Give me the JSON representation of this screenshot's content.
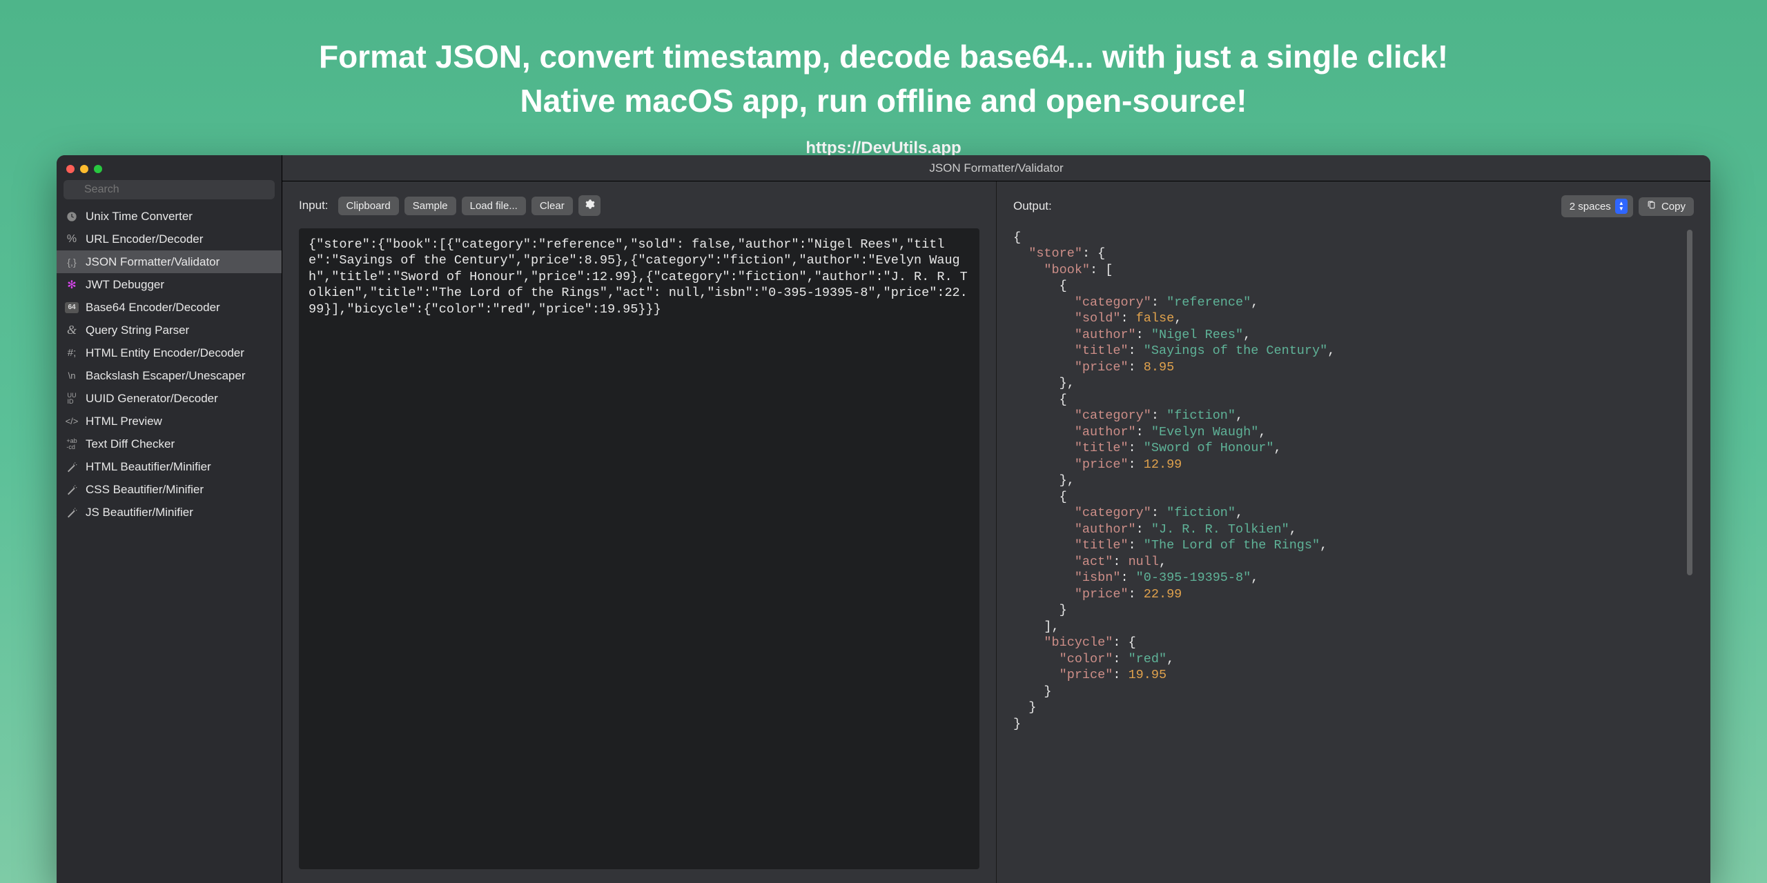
{
  "hero": {
    "line1": "Format JSON, convert timestamp, decode base64... with just a single click!",
    "line2": "Native macOS app, run offline and open-source!",
    "url": "https://DevUtils.app"
  },
  "window": {
    "title": "JSON Formatter/Validator"
  },
  "search": {
    "placeholder": "Search"
  },
  "sidebar": {
    "items": [
      {
        "label": "Unix Time Converter",
        "icon": "clock",
        "selected": false
      },
      {
        "label": "URL Encoder/Decoder",
        "icon": "percent",
        "selected": false
      },
      {
        "label": "JSON Formatter/Validator",
        "icon": "braces",
        "selected": true
      },
      {
        "label": "JWT Debugger",
        "icon": "jwt",
        "selected": false
      },
      {
        "label": "Base64 Encoder/Decoder",
        "icon": "b64",
        "selected": false
      },
      {
        "label": "Query String Parser",
        "icon": "amp",
        "selected": false
      },
      {
        "label": "HTML Entity Encoder/Decoder",
        "icon": "hash",
        "selected": false
      },
      {
        "label": "Backslash Escaper/Unescaper",
        "icon": "slashn",
        "selected": false
      },
      {
        "label": "UUID Generator/Decoder",
        "icon": "uuid",
        "selected": false
      },
      {
        "label": "HTML Preview",
        "icon": "tag",
        "selected": false
      },
      {
        "label": "Text Diff Checker",
        "icon": "diff",
        "selected": false
      },
      {
        "label": "HTML Beautifier/Minifier",
        "icon": "wand",
        "selected": false
      },
      {
        "label": "CSS Beautifier/Minifier",
        "icon": "wand",
        "selected": false
      },
      {
        "label": "JS Beautifier/Minifier",
        "icon": "wand",
        "selected": false
      }
    ]
  },
  "input": {
    "label": "Input:",
    "buttons": {
      "clipboard": "Clipboard",
      "sample": "Sample",
      "loadfile": "Load file...",
      "clear": "Clear"
    },
    "text": "{\"store\":{\"book\":[{\"category\":\"reference\",\"sold\": false,\"author\":\"Nigel Rees\",\"title\":\"Sayings of the Century\",\"price\":8.95},{\"category\":\"fiction\",\"author\":\"Evelyn Waugh\",\"title\":\"Sword of Honour\",\"price\":12.99},{\"category\":\"fiction\",\"author\":\"J. R. R. Tolkien\",\"title\":\"The Lord of the Rings\",\"act\": null,\"isbn\":\"0-395-19395-8\",\"price\":22.99}],\"bicycle\":{\"color\":\"red\",\"price\":19.95}}}"
  },
  "output": {
    "label": "Output:",
    "indent": "2 spaces",
    "copy": "Copy",
    "json": {
      "store": {
        "book": [
          {
            "category": "reference",
            "sold": false,
            "author": "Nigel Rees",
            "title": "Sayings of the Century",
            "price": 8.95
          },
          {
            "category": "fiction",
            "author": "Evelyn Waugh",
            "title": "Sword of Honour",
            "price": 12.99
          },
          {
            "category": "fiction",
            "author": "J. R. R. Tolkien",
            "title": "The Lord of the Rings",
            "act": null,
            "isbn": "0-395-19395-8",
            "price": 22.99
          }
        ],
        "bicycle": {
          "color": "red",
          "price": 19.95
        }
      }
    }
  }
}
